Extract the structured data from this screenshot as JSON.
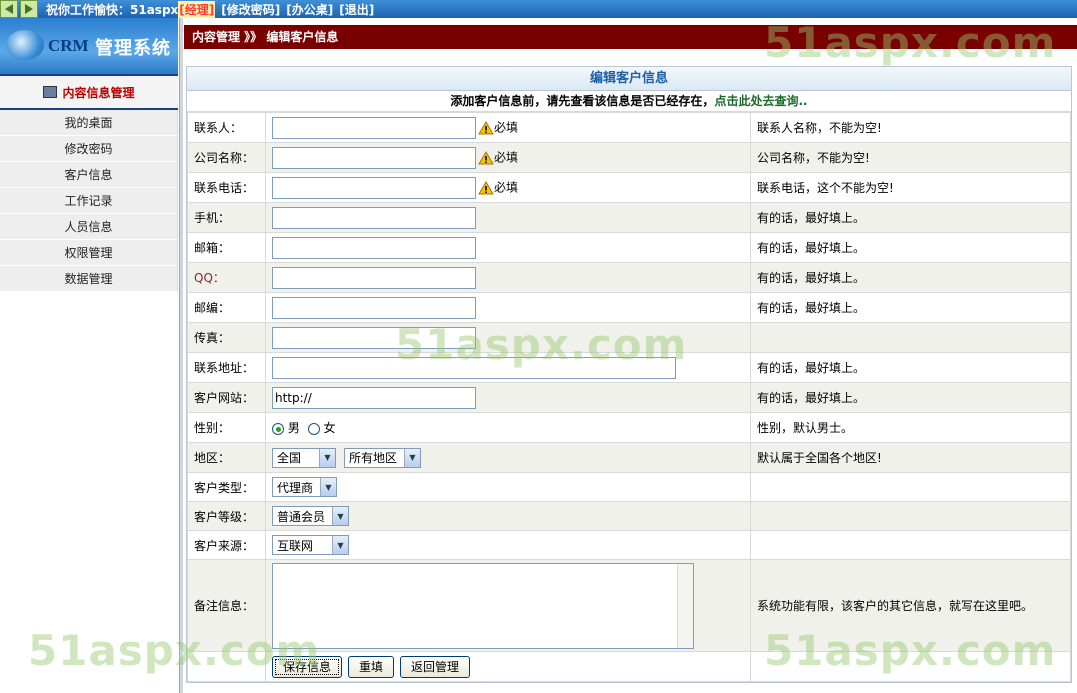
{
  "topbar": {
    "welcome": "祝你工作愉快：51aspx",
    "role": "[经理]",
    "links": [
      "[修改密码]",
      "[办公桌]",
      "[退出]"
    ]
  },
  "sidebar": {
    "logo_crm": "CRM",
    "logo_system": "管理系统",
    "section_title": "内容信息管理",
    "items": [
      "我的桌面",
      "修改密码",
      "客户信息",
      "工作记录",
      "人员信息",
      "权限管理",
      "数据管理"
    ]
  },
  "header": {
    "breadcrumb": "内容管理 》》 编辑客户信息"
  },
  "form": {
    "title": "编辑客户信息",
    "notice": "添加客户信息前，请先查看该信息是否已经存在，",
    "notice_link": "点击此处去查询..",
    "required": "必填",
    "fields": {
      "contact": {
        "label": "联系人：",
        "value": "",
        "hint": "联系人名称，不能为空!"
      },
      "company": {
        "label": "公司名称：",
        "value": "",
        "hint": "公司名称，不能为空!"
      },
      "phone": {
        "label": "联系电话：",
        "value": "",
        "hint": "联系电话，这个不能为空!"
      },
      "mobile": {
        "label": "手机：",
        "value": "",
        "hint": "有的话，最好填上。"
      },
      "email": {
        "label": "邮箱：",
        "value": "",
        "hint": "有的话，最好填上。"
      },
      "qq": {
        "label": "QQ：",
        "value": "",
        "hint": "有的话，最好填上。"
      },
      "zip": {
        "label": "邮编：",
        "value": "",
        "hint": "有的话，最好填上。"
      },
      "fax": {
        "label": "传真：",
        "value": "",
        "hint": ""
      },
      "address": {
        "label": "联系地址：",
        "value": "",
        "hint": "有的话，最好填上。"
      },
      "website": {
        "label": "客户网站：",
        "value": "http://",
        "hint": "有的话，最好填上。"
      },
      "gender": {
        "label": "性别：",
        "options": [
          "男",
          "女"
        ],
        "selected": "男",
        "hint": "性别，默认男士。"
      },
      "region": {
        "label": "地区：",
        "selected_country": "全国",
        "selected_area": "所有地区",
        "hint": "默认属于全国各个地区!"
      },
      "type": {
        "label": "客户类型：",
        "selected": "代理商"
      },
      "level": {
        "label": "客户等级：",
        "selected": "普通会员"
      },
      "source": {
        "label": "客户来源：",
        "selected": "互联网"
      },
      "remark": {
        "label": "备注信息：",
        "value": "",
        "hint": "系统功能有限，该客户的其它信息，就写在这里吧。"
      }
    },
    "buttons": {
      "save": "保存信息",
      "reset": "重填",
      "back": "返回管理"
    }
  },
  "watermark": "51aspx.com"
}
